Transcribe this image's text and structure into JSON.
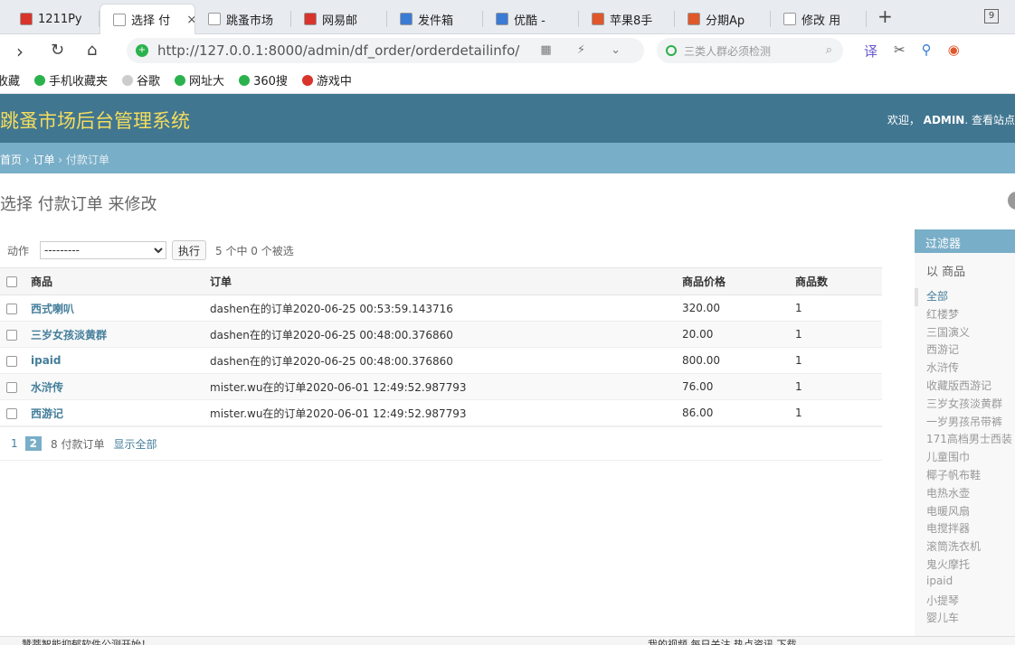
{
  "browser": {
    "tabs": [
      {
        "label": "1211Py",
        "icon_color": "#d9342b"
      },
      {
        "label": "选择 付",
        "icon_color": "#ffffff",
        "active": true
      },
      {
        "label": "跳蚤市场",
        "icon_color": "#ffffff"
      },
      {
        "label": "网易邮",
        "icon_color": "#d9342b"
      },
      {
        "label": "发件箱",
        "icon_color": "#3a7bd5"
      },
      {
        "label": "优酷 -",
        "icon_color": "#3a7bd5"
      },
      {
        "label": "苹果8手",
        "icon_color": "#e0572a"
      },
      {
        "label": "分期Ap",
        "icon_color": "#e0572a"
      },
      {
        "label": "修改 用",
        "icon_color": "#ffffff"
      }
    ],
    "tab_count": "9",
    "url_host": "http://127.0.0.1",
    "url_path": ":8000/admin/df_order/orderdetailinfo/",
    "search_placeholder": "三类人群必须检测",
    "bookmarks": [
      {
        "label": "收藏",
        "icon_color": "#f0b429"
      },
      {
        "label": "手机收藏夹",
        "icon_color": "#2bb24c"
      },
      {
        "label": "谷歌",
        "icon_color": "#cccccc"
      },
      {
        "label": "网址大",
        "icon_color": "#2bb24c"
      },
      {
        "label": "360搜",
        "icon_color": "#2bb24c"
      },
      {
        "label": "游戏中",
        "icon_color": "#d9342b"
      }
    ]
  },
  "admin": {
    "site_name": "跳蚤市场后台管理系统",
    "welcome": "欢迎，",
    "username": "ADMIN",
    "view_site": ". 查看站点",
    "breadcrumb": {
      "home": "首页",
      "app": "订单",
      "model": "付款订单"
    },
    "page_title": "选择 付款订单 来修改",
    "action_label": "动作",
    "action_default": "---------",
    "go_button": "执行",
    "selection_counter": "5 个中 0 个被选",
    "columns": {
      "product": "商品",
      "order": "订单",
      "price": "商品价格",
      "count": "商品数"
    },
    "rows": [
      {
        "product": "西式喇叭",
        "order": "dashen在的订单2020-06-25 00:53:59.143716",
        "price": "320.00",
        "count": "1"
      },
      {
        "product": "三岁女孩淡黄群",
        "order": "dashen在的订单2020-06-25 00:48:00.376860",
        "price": "20.00",
        "count": "1"
      },
      {
        "product": "ipaid",
        "order": "dashen在的订单2020-06-25 00:48:00.376860",
        "price": "800.00",
        "count": "1"
      },
      {
        "product": "水浒传",
        "order": "mister.wu在的订单2020-06-01 12:49:52.987793",
        "price": "76.00",
        "count": "1"
      },
      {
        "product": "西游记",
        "order": "mister.wu在的订单2020-06-01 12:49:52.987793",
        "price": "86.00",
        "count": "1"
      }
    ],
    "paginator": {
      "page1": "1",
      "current": "2",
      "count": "8 付款订单",
      "show_all": "显示全部"
    },
    "filter": {
      "title": "过滤器",
      "subtitle": "以 商品",
      "items": [
        "全部",
        "红楼梦",
        "三国演义",
        "西游记",
        "水浒传",
        "收藏版西游记",
        "三岁女孩淡黄群",
        "一岁男孩吊带裤",
        "171高档男士西装",
        "儿童围巾",
        "椰子帆布鞋",
        "电热水壶",
        "电暖风扇",
        "电搅拌器",
        "滚筒洗衣机",
        "鬼火摩托",
        "ipaid",
        "小提琴",
        "婴儿车"
      ]
    }
  },
  "statusbar": {
    "left": "赞蒂智能抑郁软件公测开始！",
    "right": "我的视频   每日关注   热点资讯   下载"
  },
  "colors": {
    "header": "#417690",
    "breadcrumbs": "#79aec8",
    "site_name": "#f5dd5d",
    "link": "#447e9b"
  }
}
